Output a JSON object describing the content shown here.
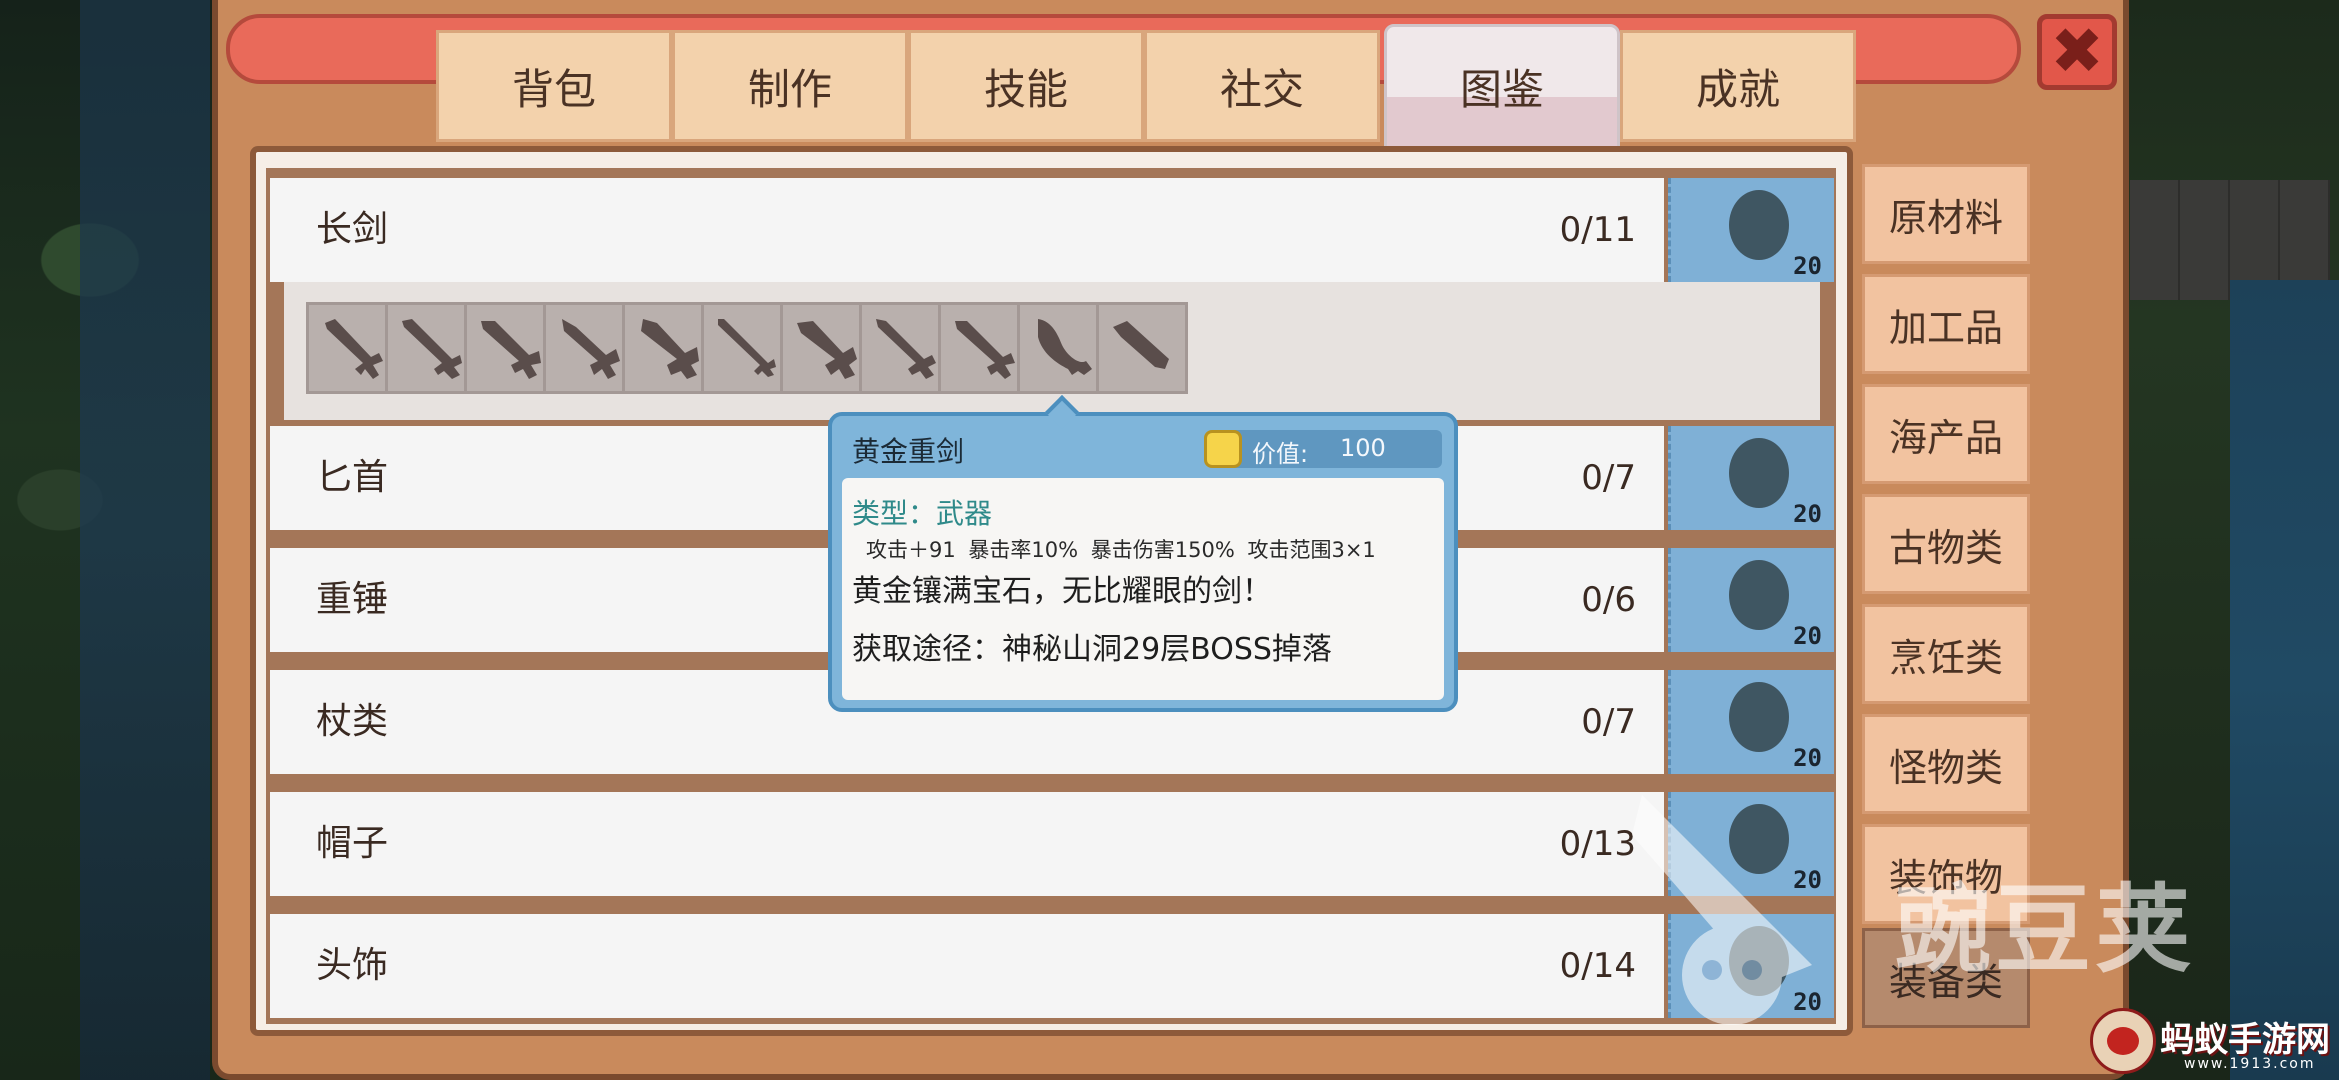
{
  "tabs": [
    {
      "label": "背包"
    },
    {
      "label": "制作"
    },
    {
      "label": "技能"
    },
    {
      "label": "社交"
    },
    {
      "label": "图鉴",
      "active": true
    },
    {
      "label": "成就"
    }
  ],
  "close_button": {
    "icon": "close-icon"
  },
  "categories": [
    {
      "name": "长剑",
      "count": "0/11",
      "badge": "20"
    },
    {
      "name": "匕首",
      "count": "0/7",
      "badge": "20"
    },
    {
      "name": "重锤",
      "count": "0/6",
      "badge": "20"
    },
    {
      "name": "杖类",
      "count": "0/7",
      "badge": "20"
    },
    {
      "name": "帽子",
      "count": "0/13",
      "badge": "20"
    },
    {
      "name": "头饰",
      "count": "0/14",
      "badge": "20"
    }
  ],
  "sword_slots": {
    "count": 11,
    "icon": "sword-silhouette-icon"
  },
  "side_categories": [
    {
      "label": "原材料"
    },
    {
      "label": "加工品"
    },
    {
      "label": "海产品"
    },
    {
      "label": "古物类"
    },
    {
      "label": "烹饪类"
    },
    {
      "label": "怪物类"
    },
    {
      "label": "装饰物"
    },
    {
      "label": "装备类",
      "active": true
    }
  ],
  "tooltip": {
    "name": "黄金重剑",
    "value_label": "价值:",
    "value": "100",
    "type_line": "类型：武器",
    "stats": "攻击＋91  暴击率10%  暴击伤害150%  攻击范围3×1",
    "description": "黄金镶满宝石，无比耀眼的剑！",
    "source": "获取途径：神秘山洞29层BOSS掉落"
  },
  "watermark": {
    "text": "豌豆荚"
  },
  "logo": {
    "brand": "蚂蚁手游网",
    "url": "www.1913.com"
  },
  "colors": {
    "frame": "#c98a5c",
    "tab": "#f3d2ac",
    "tab_active": "#f0e8ea",
    "badge": "#7fb0d6",
    "side_button": "#f2c3a0",
    "tooltip": "#7fb5da"
  }
}
